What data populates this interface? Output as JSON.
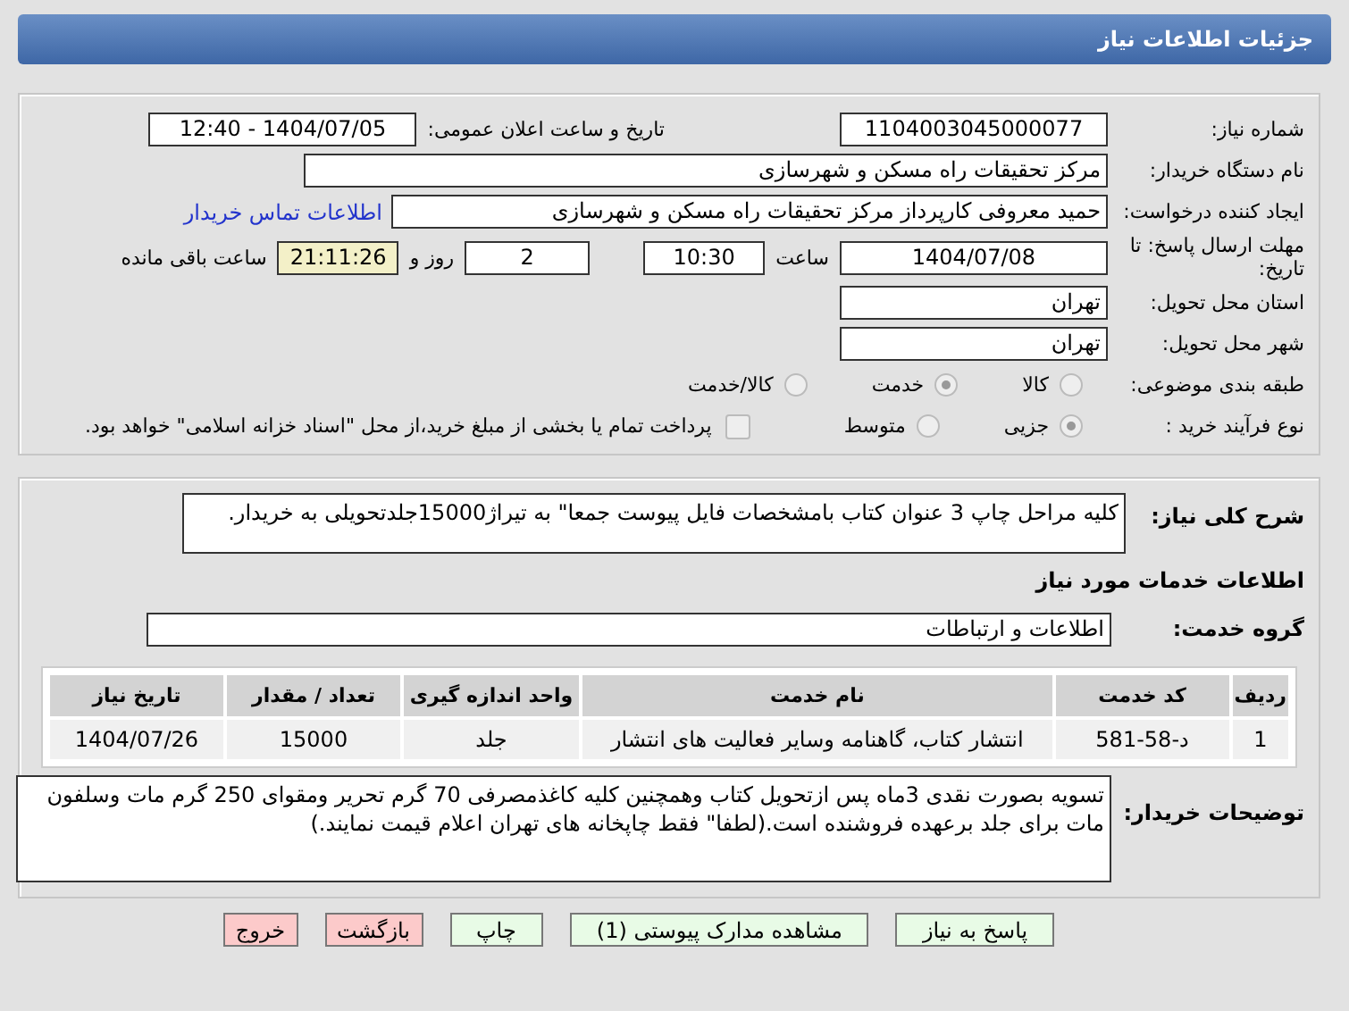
{
  "header": {
    "title": "جزئیات اطلاعات نیاز"
  },
  "need_number": {
    "label": "شماره نیاز:",
    "value": "1104003045000077"
  },
  "announce": {
    "label": "تاریخ و ساعت اعلان عمومی:",
    "value": "1404/07/05 - 12:40"
  },
  "buyer": {
    "label": "نام دستگاه خریدار:",
    "value": "مرکز تحقیقات راه  مسکن و شهرسازی"
  },
  "creator": {
    "label": "ایجاد کننده درخواست:",
    "value": "حمید معروفی کارپرداز مرکز تحقیقات راه  مسکن و شهرسازی",
    "link": "اطلاعات تماس خریدار"
  },
  "deadline": {
    "label": "مهلت ارسال پاسخ: تا تاریخ:",
    "date": "1404/07/08",
    "time_label": "ساعت",
    "time": "10:30",
    "days": "2",
    "days_label": "روز و",
    "remaining": "21:11:26",
    "remaining_label": "ساعت باقی مانده"
  },
  "province": {
    "label": "استان محل تحویل:",
    "value": "تهران"
  },
  "city": {
    "label": "شهر محل تحویل:",
    "value": "تهران"
  },
  "category": {
    "label": "طبقه بندی موضوعی:",
    "options": [
      {
        "label": "کالا",
        "selected": false
      },
      {
        "label": "خدمت",
        "selected": true
      },
      {
        "label": "کالا/خدمت",
        "selected": false
      }
    ]
  },
  "process": {
    "label": "نوع فرآیند خرید :",
    "options": [
      {
        "label": "جزیی",
        "selected": true
      },
      {
        "label": "متوسط",
        "selected": false
      }
    ],
    "payment": {
      "label": "پرداخت تمام یا بخشی از مبلغ خرید،از محل \"اسناد خزانه اسلامی\" خواهد بود.",
      "checked": false
    }
  },
  "description": {
    "label": "شرح کلی نیاز:",
    "value": "کلیه مراحل چاپ 3 عنوان کتاب بامشخصات فایل پیوست جمعا\" به تیراژ15000جلدتحویلی به خریدار."
  },
  "services_title": "اطلاعات خدمات مورد نیاز",
  "service_group": {
    "label": "گروه خدمت:",
    "value": "اطلاعات و ارتباطات"
  },
  "table": {
    "columns": [
      "ردیف",
      "کد خدمت",
      "نام خدمت",
      "واحد اندازه گیری",
      "تعداد / مقدار",
      "تاریخ نیاز"
    ],
    "rows": [
      [
        "1",
        "د-58-581",
        "انتشار کتاب، گاهنامه وسایر فعالیت های انتشار",
        "جلد",
        "15000",
        "1404/07/26"
      ]
    ]
  },
  "notes": {
    "label": "توضیحات خریدار:",
    "value": "تسویه بصورت نقدی 3ماه پس ازتحویل کتاب وهمچنین کلیه کاغذمصرفی 70 گرم تحریر ومقوای 250 گرم مات وسلفون مات برای جلد برعهده فروشنده است.(لطفا\" فقط چاپخانه های تهران اعلام قیمت نمایند.)"
  },
  "buttons": [
    {
      "label": "پاسخ به نیاز",
      "kind": "primary"
    },
    {
      "label": "مشاهده مدارک پیوستی (1)",
      "kind": "primary"
    },
    {
      "label": "چاپ",
      "kind": "primary"
    },
    {
      "label": "بازگشت",
      "kind": "danger"
    },
    {
      "label": "خروج",
      "kind": "danger"
    }
  ]
}
